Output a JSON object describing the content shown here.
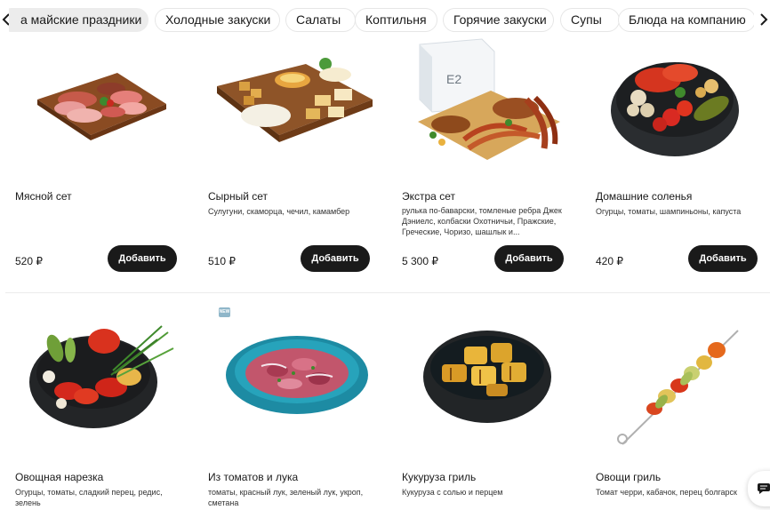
{
  "categories": [
    {
      "label": "а майские праздники",
      "active": true
    },
    {
      "label": "Холодные закуски",
      "active": false
    },
    {
      "label": "Салаты",
      "active": false
    },
    {
      "label": "Коптильня",
      "active": false
    },
    {
      "label": "Горячие закуски",
      "active": false
    },
    {
      "label": "Супы",
      "active": false
    },
    {
      "label": "Блюда на компанию",
      "active": false
    }
  ],
  "nav_icons": {
    "prev": "chevron-left-icon",
    "next": "chevron-right-icon"
  },
  "products": [
    {
      "title": "Мясной сет",
      "description": "",
      "price": "520 ₽",
      "button": "Добавить",
      "image": "meat-platter"
    },
    {
      "title": "Сырный сет",
      "description": "Сулугуни, скаморца, чечил, камамбер",
      "price": "510 ₽",
      "button": "Добавить",
      "image": "cheese-platter"
    },
    {
      "title": "Экстра сет",
      "description": "рулька по-баварски, томленые ребра Джек Дэниелс, колбаски Охотничьи, Пражские, Греческие, Чоризо, шашлык и...",
      "price": "5 300 ₽",
      "button": "Добавить",
      "image": "extra-set"
    },
    {
      "title": "Домашние соленья",
      "description": "Огурцы, томаты, шампиньоны, капуста",
      "price": "420 ₽",
      "button": "Добавить",
      "image": "pickles-bowl"
    },
    {
      "title": "Овощная нарезка",
      "description": "Огурцы, томаты, сладкий перец, редис, зелень",
      "image": "vegetables-bowl"
    },
    {
      "title": "Из томатов и лука",
      "description": "томаты, красный лук, зеленый лук, укроп, сметана",
      "image": "tomato-onion-salad",
      "badge": "NEW"
    },
    {
      "title": "Кукуруза гриль",
      "description": "Кукуруза с солью и перцем",
      "image": "grilled-corn"
    },
    {
      "title": "Овощи гриль",
      "description": "Томат черри, кабачок, перец болгарск",
      "image": "grilled-vegetables-skewer"
    }
  ],
  "chat": {
    "icon": "chat-icon"
  }
}
